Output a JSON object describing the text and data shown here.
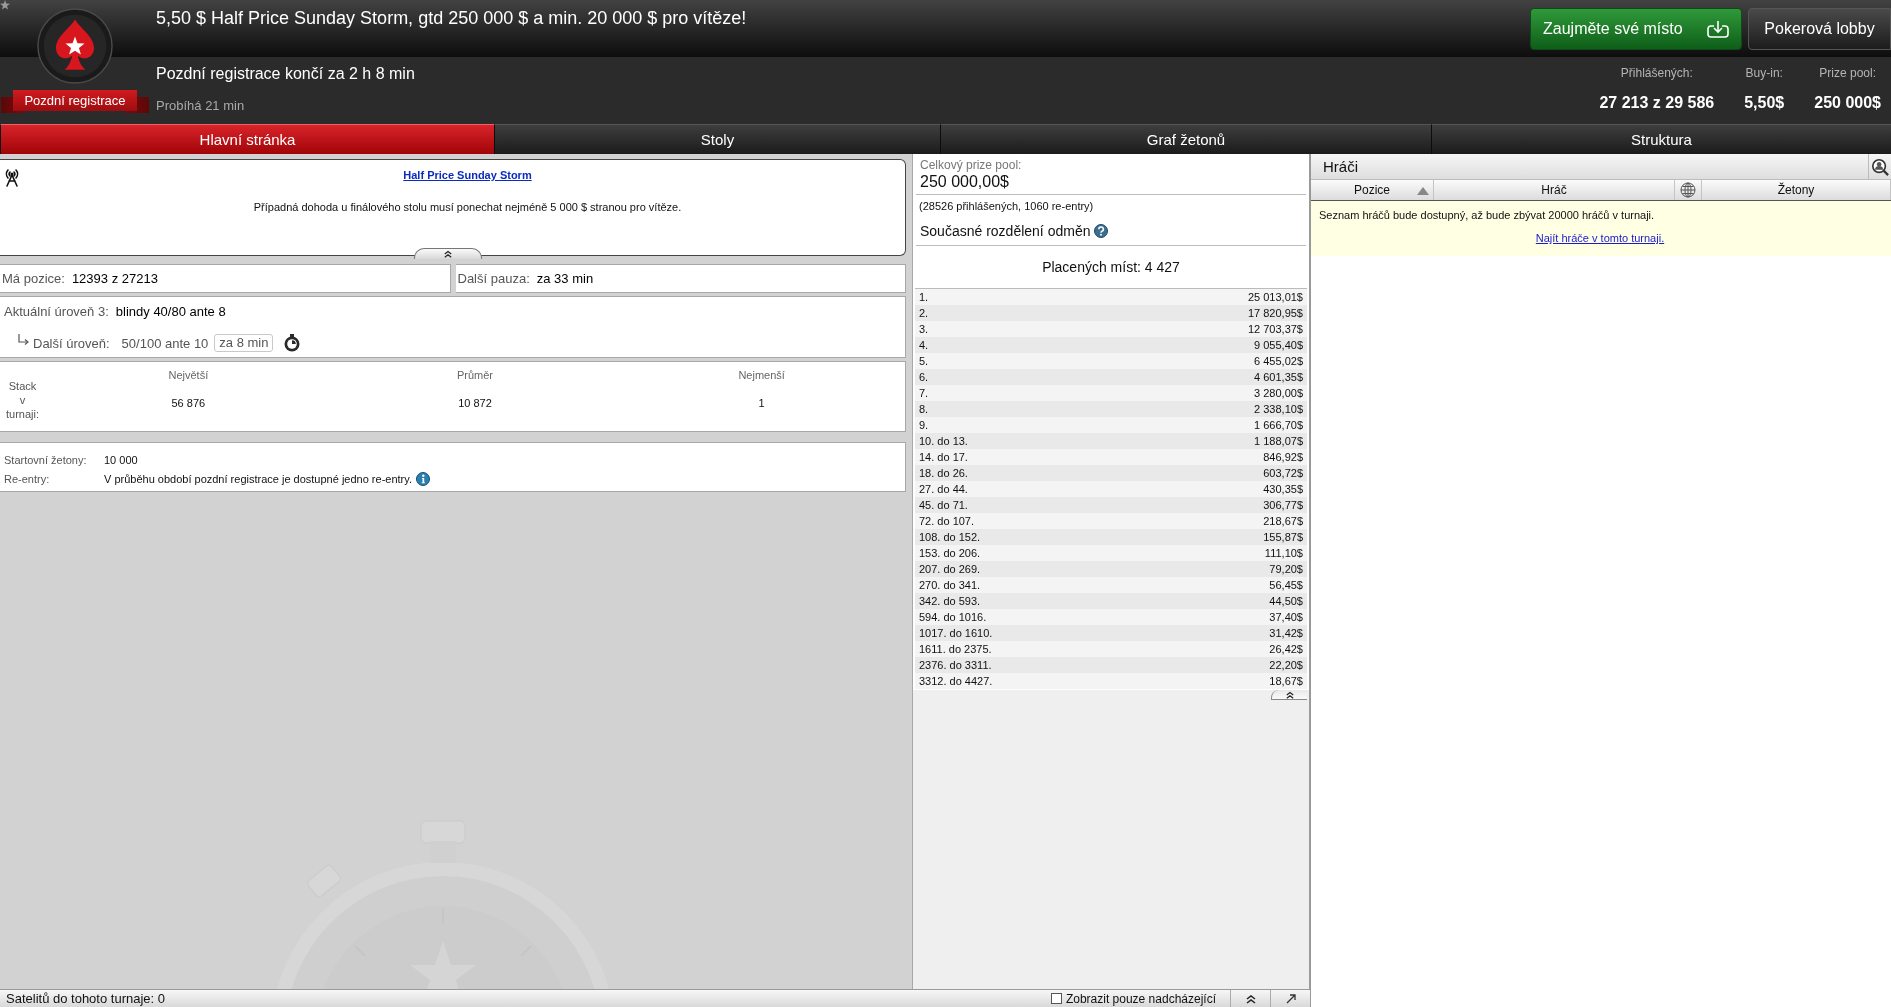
{
  "header": {
    "title": "5,50 $ Half Price Sunday Storm, gtd 250 000 $ a min. 20 000 $ pro vítěze!",
    "badge": "Pozdní registrace",
    "late_registration": "Pozdní registrace končí za 2 h 8 min",
    "running": "Probíhá 21 min",
    "buttons": [
      {
        "label": "Zaujměte své místo",
        "kind": "primary"
      },
      {
        "label": "Pokerová lobby",
        "kind": "secondary"
      }
    ],
    "stats": [
      {
        "label": "Přihlášených:",
        "value": "27 213 z 29 586"
      },
      {
        "label": "Buy-in:",
        "value": "5,50$"
      },
      {
        "label": "Prize pool:",
        "value": "250 000$"
      }
    ]
  },
  "tabs": [
    {
      "label": "Hlavní stránka",
      "selected": true
    },
    {
      "label": "Stoly",
      "selected": false
    },
    {
      "label": "Graf žetonů",
      "selected": false
    },
    {
      "label": "Struktura",
      "selected": false
    }
  ],
  "announcement": {
    "title": "Half Price Sunday Storm",
    "message": "Případná dohoda u finálového stolu musí ponechat nejméně 5 000 $ stranou pro vítěze."
  },
  "position": {
    "label": "Má pozice:",
    "value": "12393 z 27213"
  },
  "next_break": {
    "label": "Další pauza:",
    "value": "za 33 min"
  },
  "level": {
    "label": "Aktuální úroveň 3:",
    "value": "blindy 40/80 ante 8",
    "next_label": "Další úroveň:",
    "next_value": "50/100 ante 10",
    "countdown": "za 8 min"
  },
  "stacks": {
    "label": "Stack v turnaji:",
    "columns": [
      {
        "heading": "Největší",
        "value": "56 876"
      },
      {
        "heading": "Průměr",
        "value": "10 872"
      },
      {
        "heading": "Nejmenší",
        "value": "1"
      }
    ]
  },
  "details": [
    {
      "label": "Startovní žetony:",
      "value": "10 000",
      "help": false
    },
    {
      "label": "Re-entry:",
      "value": "V průběhu období pozdní registrace je dostupné jedno re-entry.",
      "help": true
    }
  ],
  "prize_pool": {
    "label": "Celkový prize pool:",
    "value": "250 000,00$",
    "entries": "(28526 přihlášených, 1060 re-entry)",
    "distribution": {
      "label": "Současné rozdělení odměn",
      "help": true
    },
    "paid_places": "Placených míst: 4 427",
    "payouts": [
      {
        "place": "1.",
        "prize": "25 013,01$"
      },
      {
        "place": "2.",
        "prize": "17 820,95$"
      },
      {
        "place": "3.",
        "prize": "12 703,37$"
      },
      {
        "place": "4.",
        "prize": "9 055,40$"
      },
      {
        "place": "5.",
        "prize": "6 455,02$"
      },
      {
        "place": "6.",
        "prize": "4 601,35$"
      },
      {
        "place": "7.",
        "prize": "3 280,00$"
      },
      {
        "place": "8.",
        "prize": "2 338,10$"
      },
      {
        "place": "9.",
        "prize": "1 666,70$"
      },
      {
        "place": "10. do 13.",
        "prize": "1 188,07$"
      },
      {
        "place": "14. do 17.",
        "prize": "846,92$"
      },
      {
        "place": "18. do 26.",
        "prize": "603,72$"
      },
      {
        "place": "27. do 44.",
        "prize": "430,35$"
      },
      {
        "place": "45. do 71.",
        "prize": "306,77$"
      },
      {
        "place": "72. do 107.",
        "prize": "218,67$"
      },
      {
        "place": "108. do 152.",
        "prize": "155,87$"
      },
      {
        "place": "153. do 206.",
        "prize": "111,10$"
      },
      {
        "place": "207. do 269.",
        "prize": "79,20$"
      },
      {
        "place": "270. do 341.",
        "prize": "56,45$"
      },
      {
        "place": "342. do 593.",
        "prize": "44,50$"
      },
      {
        "place": "594. do 1016.",
        "prize": "37,40$"
      },
      {
        "place": "1017. do 1610.",
        "prize": "31,42$"
      },
      {
        "place": "1611. do 2375.",
        "prize": "26,42$"
      },
      {
        "place": "2376. do 3311.",
        "prize": "22,20$"
      },
      {
        "place": "3312. do 4427.",
        "prize": "18,67$"
      }
    ]
  },
  "players": {
    "title": "Hráči",
    "columns": [
      {
        "kind": "text",
        "label": "Pozice",
        "sorted": true
      },
      {
        "kind": "text",
        "label": "Hráč",
        "sorted": false
      },
      {
        "kind": "globe",
        "sorted": false
      },
      {
        "kind": "text",
        "label": "Žetony",
        "sorted": false
      }
    ],
    "notice": "Seznam hráčů bude dostupný, až bude zbývat 20000 hráčů v turnaji.",
    "link": "Najít hráče v tomto turnaji."
  },
  "status_bar": {
    "satellites": "Satelitů do tohoto turnaje: 0",
    "filter": {
      "label": "Zobrazit pouze nadcházející",
      "checked": false
    }
  }
}
